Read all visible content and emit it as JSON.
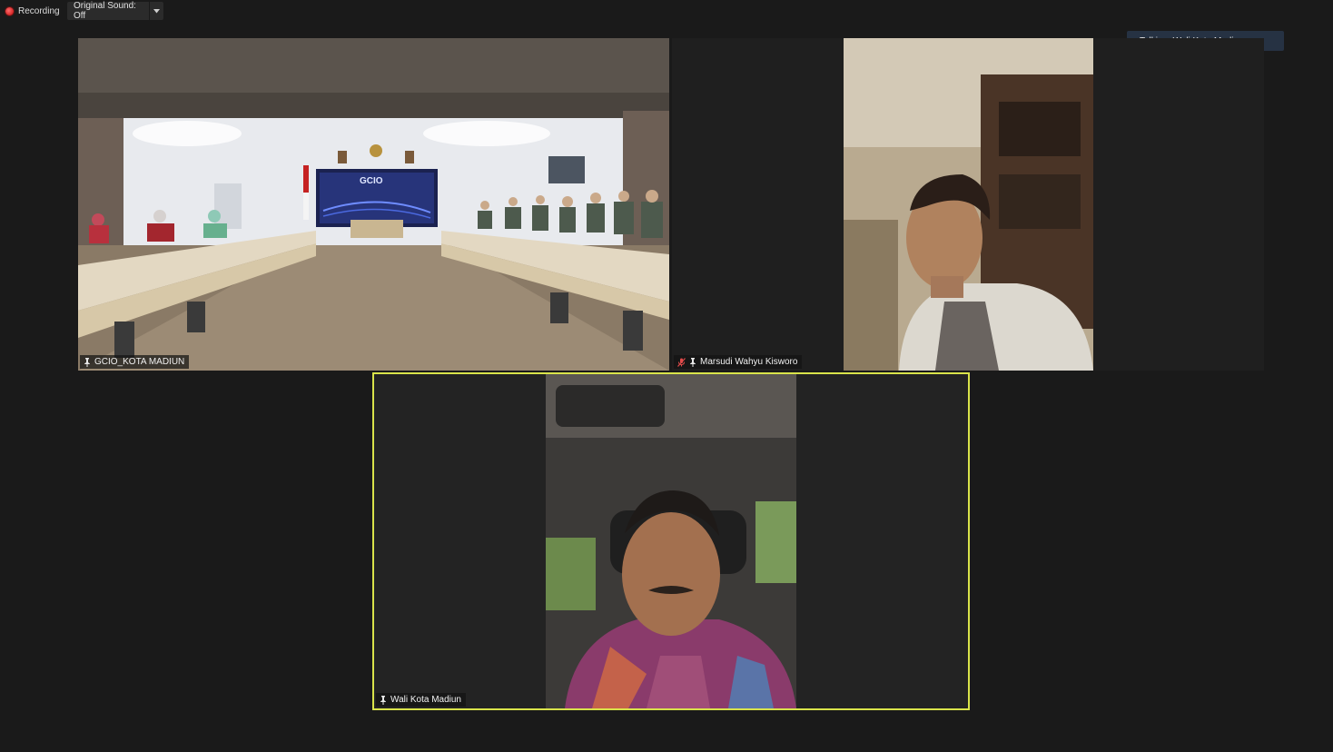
{
  "top_bar": {
    "recording_label": "Recording",
    "original_sound_label": "Original Sound: Off"
  },
  "talking_indicator": "Talking: Wali Kota Madiun",
  "participants": [
    {
      "name": "GCIO_KOTA MADIUN",
      "pinned": true,
      "muted": false
    },
    {
      "name": "Marsudi Wahyu Kisworo",
      "pinned": true,
      "muted": true
    },
    {
      "name": "Wali Kota Madiun",
      "pinned": true,
      "muted": false,
      "active_speaker": true
    }
  ],
  "screen_text": {
    "gcio_screen_title": "GCIO"
  },
  "colors": {
    "background": "#1a1a1a",
    "active_speaker_border": "#d9e34a",
    "talking_badge": "#263243",
    "muted_icon": "#e24b4b"
  }
}
